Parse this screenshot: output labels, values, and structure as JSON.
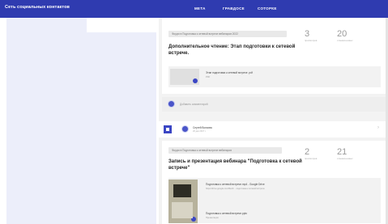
{
  "app": {
    "title": "Сеть социальных контактов"
  },
  "nav": {
    "items": [
      "МЕТА",
      "ГРАВДОСЕ",
      "СОТОРКЕ"
    ]
  },
  "feed": {
    "comment_placeholder": "Добавить комментарий",
    "posts": [
      {
        "chip": "Форум в Подготовка к сетевой встрече вебинаров 2022",
        "title": "Дополнительное чтение: Этап подготовки к сетевой встрече.",
        "stats": [
          {
            "num": "3",
            "label": "просмотров"
          },
          {
            "num": "20",
            "label": "отзывов-новых"
          }
        ],
        "attachment": {
          "title": "Этап подготовки к сетевой встрече .pdf",
          "sub": "PDF"
        }
      },
      {
        "author": "Сергей Волкова",
        "date": "20 дек 2017 г.",
        "chip": "Форум в Подготовка к сетевой встрече вебинаров",
        "title": "Запись и презентация вебинара \"Подготовка к сетевой встрече\"",
        "stats": [
          {
            "num": "2",
            "label": "просмотров"
          },
          {
            "num": "21",
            "label": "отзывов-новых"
          }
        ],
        "attachments": [
          {
            "title": "Подготовка к сетевой встрече.mp4 - Google Drive",
            "sub": "https://drive.google.com/file/d/... подготовка к сетевой встрече"
          },
          {
            "title": "Подготовка к сетевой встрече.pptx",
            "sub": "Презентация"
          }
        ]
      }
    ]
  },
  "colors": {
    "brand": "#2f3bb0",
    "accent": "#3b46c4",
    "sidebar": "#eceefa"
  }
}
